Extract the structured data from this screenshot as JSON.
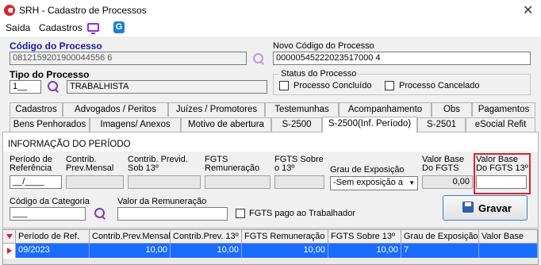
{
  "window": {
    "title": "SRH - Cadastro de Processos"
  },
  "menu": {
    "items": [
      "Saída",
      "Cadastros"
    ]
  },
  "form": {
    "codigo_label": "Código do Processo",
    "codigo_value": "0812159201900044556 6",
    "novo_codigo_label": "Novo Código do Processo",
    "novo_codigo_value": "00000545222023517000 4",
    "tipo_label": "Tipo do Processo",
    "tipo_code": "1__",
    "tipo_desc": "TRABALHISTA",
    "status_label": "Status do Processo",
    "status_concluido": "Processo Concluído",
    "status_cancelado": "Processo Cancelado"
  },
  "tabs_row1": [
    "Cadastros",
    "Advogados / Peritos",
    "Juízes / Promotores",
    "Testemunhas",
    "Acompanhamento",
    "Obs",
    "Pagamentos"
  ],
  "tabs_row2": [
    "Bens Penhorados",
    "Imagens/ Anexos",
    "Motivo de abertura",
    "S-2500",
    "S-2500(Inf. Período)",
    "S-2501",
    "eSocial Refit"
  ],
  "panel": {
    "header": "INFORMAÇÃO DO PERÍODO",
    "periodo_ref_label1": "Período de",
    "periodo_ref_label2": "Referência",
    "periodo_ref_value": "__/____",
    "contrib_prev_mensal_label1": "Contrib.",
    "contrib_prev_mensal_label2": "Prev.Mensal",
    "contrib_prev_13_label1": "Contrib. Previd.",
    "contrib_prev_13_label2": "Sob 13º",
    "fgts_rem_label1": "FGTS",
    "fgts_rem_label2": "Remuneração",
    "fgts_13_label1": "FGTS Sobre",
    "fgts_13_label2": "o 13º",
    "grau_label": "Grau de Exposição",
    "grau_value": "-Sem exposição a",
    "valor_base_fgts_label1": "Valor Base",
    "valor_base_fgts_label2": "Do FGTS",
    "valor_base_fgts_value": "0,00",
    "valor_base_fgts13_label1": "Valor Base",
    "valor_base_fgts13_label2": "Do FGTS 13º",
    "codigo_categoria_label": "Código da Categoria",
    "codigo_categoria_value": "___",
    "valor_remuneracao_label": "Valor da Remuneração",
    "fgts_pago_label": "FGTS pago ao Trabalhador",
    "gravar_label": "Gravar"
  },
  "grid": {
    "columns": [
      "Período de Ref.",
      "Contrib.Prev.Mensal",
      "Contrib.Prev. 13º",
      "FGTS Remuneração",
      "FGTS Sobre 13º",
      "Grau de Exposição",
      "Valor Base"
    ],
    "rows": [
      [
        "09/2023",
        "10,00",
        "10,00",
        "10,00",
        "10,00",
        "7",
        ""
      ]
    ]
  },
  "colors": {
    "accent": "#1a6cff",
    "highlight": "#d9242a"
  }
}
